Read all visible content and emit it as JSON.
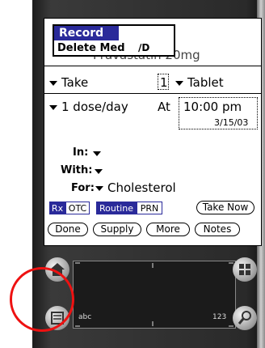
{
  "menu": {
    "title": "Record",
    "item": "Delete Med",
    "shortcut": "∕D"
  },
  "background_title": "Pravastatin 20mg",
  "take": {
    "label": "Take",
    "quantity": "1",
    "unit": "Tablet"
  },
  "schedule": {
    "frequency": "1 dose/day",
    "at_label": "At",
    "time": "10:00 pm",
    "date": "3/15/03"
  },
  "fields": {
    "in_label": "In:",
    "with_label": "With:",
    "for_label": "For:",
    "for_value": "Cholesterol"
  },
  "segments": {
    "rx": "Rx",
    "otc": "OTC",
    "routine": "Routine",
    "prn": "PRN"
  },
  "buttons": {
    "take_now": "Take Now",
    "done": "Done",
    "supply": "Supply",
    "more": "More",
    "notes": "Notes"
  },
  "graffiti": {
    "left_mark": "abc",
    "right_mark": "123"
  },
  "colors": {
    "highlight": "#2a2a9a",
    "annotation": "#e11111"
  }
}
